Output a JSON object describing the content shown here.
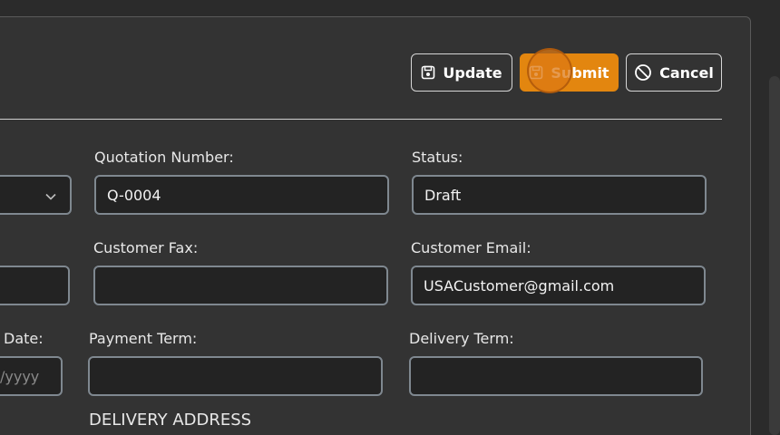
{
  "toolbar": {
    "update_label": "Update",
    "submit_label": "Submit",
    "cancel_label": "Cancel"
  },
  "form": {
    "quotation_number": {
      "label": "Quotation Number:",
      "value": "Q-0004"
    },
    "status": {
      "label": "Status:",
      "value": "Draft"
    },
    "customer_fax": {
      "label": "Customer Fax:",
      "value": ""
    },
    "customer_email": {
      "label": "Customer Email:",
      "value": "USACustomer@gmail.com"
    },
    "date": {
      "label": "Date:",
      "placeholder": "/yyyy"
    },
    "payment_term": {
      "label": "Payment Term:",
      "value": ""
    },
    "delivery_term": {
      "label": "Delivery Term:",
      "value": ""
    }
  },
  "sections": {
    "delivery_address": "DELIVERY ADDRESS"
  },
  "colors": {
    "accent": "#e3860f",
    "background": "#333333",
    "field_background": "#232323",
    "field_border": "#7f8890"
  },
  "icons": {
    "update": "save-icon",
    "submit": "save-icon",
    "cancel": "ban-icon",
    "dropdown": "chevron-down-icon"
  }
}
